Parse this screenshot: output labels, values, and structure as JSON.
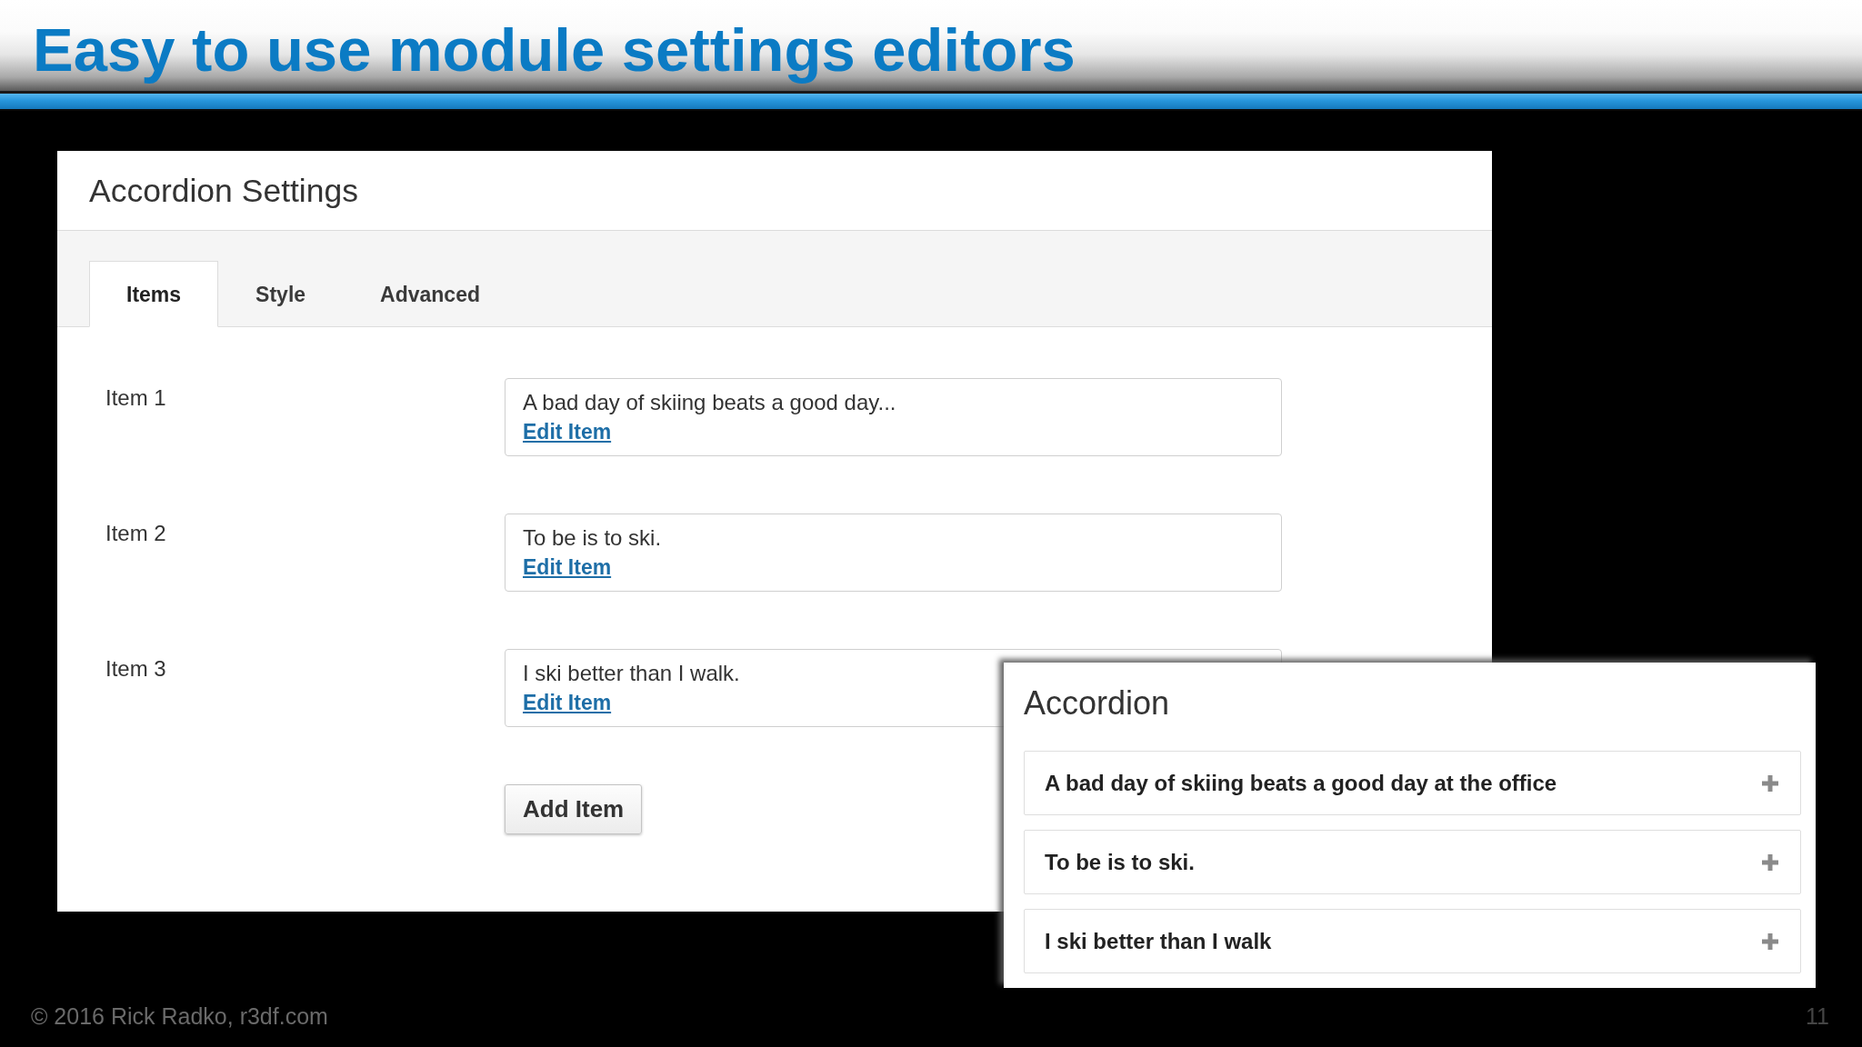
{
  "slide": {
    "title": "Easy to use module settings editors"
  },
  "settings_panel": {
    "title": "Accordion Settings",
    "tabs": [
      {
        "label": "Items",
        "selected": true
      },
      {
        "label": "Style",
        "selected": false
      },
      {
        "label": "Advanced",
        "selected": false
      }
    ],
    "items": [
      {
        "label": "Item 1",
        "summary": "A bad day of skiing beats a good day...",
        "action": "Edit Item"
      },
      {
        "label": "Item 2",
        "summary": "To be is to ski.",
        "action": "Edit Item"
      },
      {
        "label": "Item 3",
        "summary": "I ski better than I walk.",
        "action": "Edit Item"
      }
    ],
    "add_button": "Add Item"
  },
  "preview": {
    "title": "Accordion",
    "sections": [
      {
        "heading": "A bad day of skiing beats a good day at the office",
        "expanded": false
      },
      {
        "heading": "To be is to ski.",
        "expanded": false
      },
      {
        "heading": "I ski better than I walk",
        "expanded": false
      }
    ]
  },
  "footer": {
    "copyright": "© 2016 Rick Radko, r3df.com",
    "page_number": "11"
  }
}
